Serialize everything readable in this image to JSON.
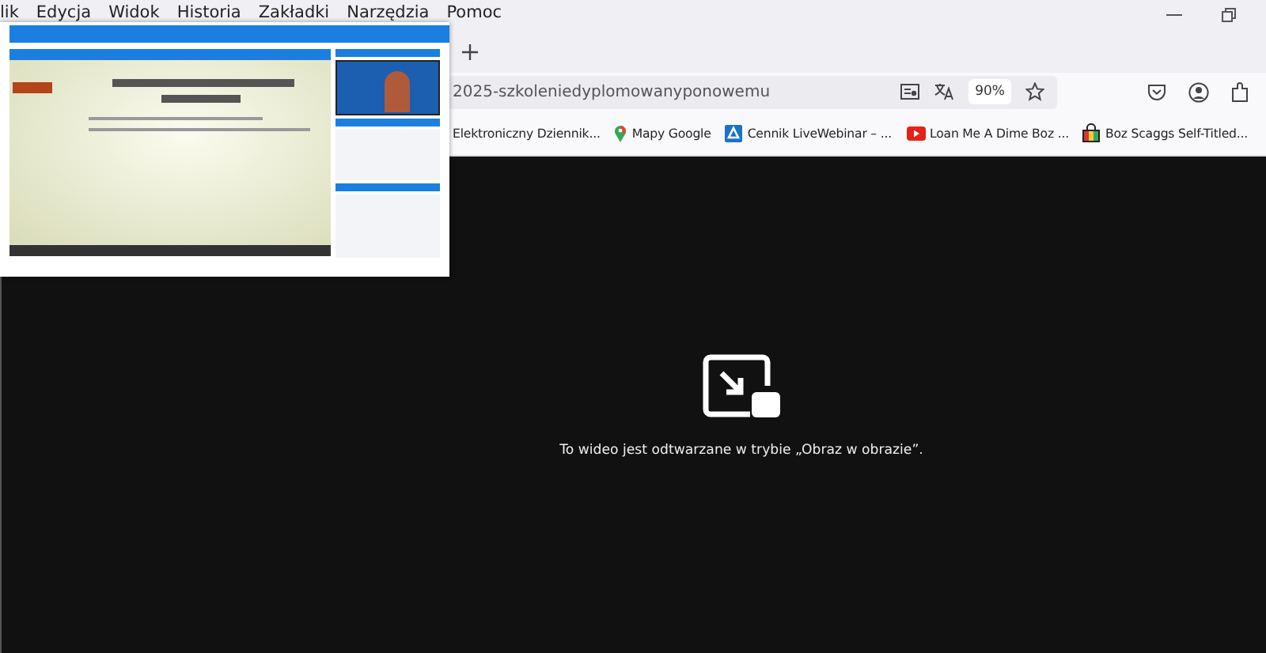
{
  "menu_bar": [
    "lik",
    "Edycja",
    "Widok",
    "Historia",
    "Zakładki",
    "Narzędzia",
    "Pomoc"
  ],
  "address_bar": {
    "url": "2025-szkoleniedyplomowanyponowemu",
    "zoom": "90%"
  },
  "bookmarks": [
    {
      "label": "Elektroniczny Dziennik...",
      "kind": "none"
    },
    {
      "label": "Mapy Google",
      "kind": "pin"
    },
    {
      "label": "Cennik LiveWebinar – ...",
      "kind": "webinar"
    },
    {
      "label": "Loan Me A Dime Boz ...",
      "kind": "play"
    },
    {
      "label": "Boz Scaggs Self-Titled...",
      "kind": "bag"
    }
  ],
  "video_notice": "To wideo jest odtwarzane w trybie „Obraz w obrazie”."
}
